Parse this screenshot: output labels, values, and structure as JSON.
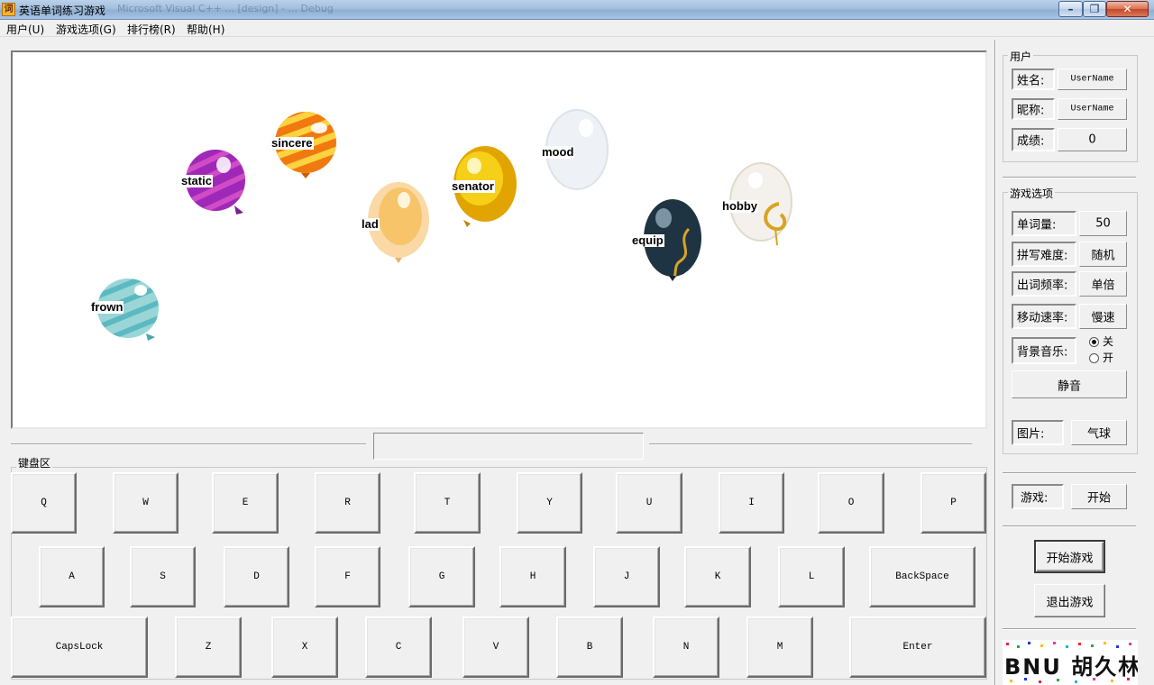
{
  "window": {
    "title": "英语单词练习游戏",
    "icon_glyph": "词",
    "ghost_title": "Microsoft Visual C++ ... [design] - ... Debug"
  },
  "menu": [
    "用户(U)",
    "游戏选项(G)",
    "排行榜(R)",
    "帮助(H)"
  ],
  "balloons": [
    {
      "word": "sincere",
      "color": "orange-striped"
    },
    {
      "word": "static",
      "color": "purple-striped"
    },
    {
      "word": "mood",
      "color": "white"
    },
    {
      "word": "senator",
      "color": "yellow"
    },
    {
      "word": "lad",
      "color": "peach"
    },
    {
      "word": "hobby",
      "color": "white-gold-ribbon"
    },
    {
      "word": "equip",
      "color": "dark-teal-gold-ribbon"
    },
    {
      "word": "frown",
      "color": "teal-striped"
    }
  ],
  "input": {
    "value": ""
  },
  "keyboard": {
    "title": "键盘区",
    "row1": [
      "Q",
      "W",
      "E",
      "R",
      "T",
      "Y",
      "U",
      "I",
      "O",
      "P"
    ],
    "row2": [
      "A",
      "S",
      "D",
      "F",
      "G",
      "H",
      "J",
      "K",
      "L",
      "BackSpace"
    ],
    "row3": [
      "CapsLock",
      "Z",
      "X",
      "C",
      "V",
      "B",
      "N",
      "M",
      "Enter"
    ]
  },
  "user": {
    "title": "用户",
    "name_label": "姓名:",
    "name_value": "UserName",
    "nick_label": "昵称:",
    "nick_value": "UserName",
    "score_label": "成绩:",
    "score_value": "0"
  },
  "options": {
    "title": "游戏选项",
    "words_label": "单词量:",
    "words_value": "50",
    "difficulty_label": "拼写难度:",
    "difficulty_value": "随机",
    "frequency_label": "出词频率:",
    "frequency_value": "单倍",
    "speed_label": "移动速率:",
    "speed_value": "慢速",
    "music_label": "背景音乐:",
    "music_off": "关",
    "music_on": "开",
    "mute_button": "静音",
    "picture_label": "图片:",
    "picture_value": "气球"
  },
  "game": {
    "status_label": "游戏:",
    "status_value": "开始",
    "start_button": "开始游戏",
    "exit_button": "退出游戏"
  },
  "logo": {
    "text": "BNU 胡久林"
  },
  "colors": {
    "titlebar": "#a3bfdd",
    "window_bg": "#f0f0f0",
    "close": "#c4472a"
  }
}
